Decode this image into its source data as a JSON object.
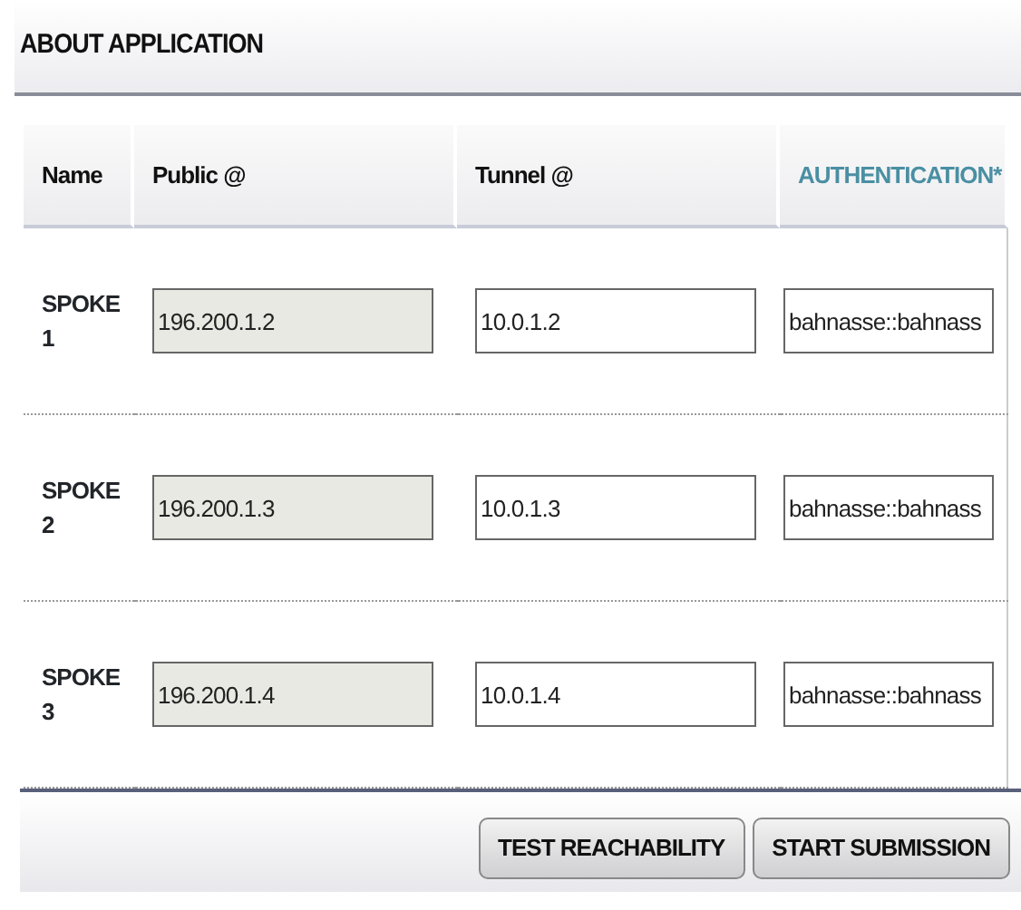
{
  "panel": {
    "title": "ABOUT APPLICATION"
  },
  "table": {
    "columns": [
      {
        "label": "Name",
        "highlighted": false
      },
      {
        "label": "Public @",
        "highlighted": false
      },
      {
        "label": "Tunnel @",
        "highlighted": false
      },
      {
        "label": "AUTHENTICATION*",
        "highlighted": true
      }
    ],
    "rows": [
      {
        "name": "SPOKE 1",
        "public": {
          "value": "196.200.1.2",
          "disabled": true
        },
        "tunnel": {
          "value": "10.0.1.2",
          "disabled": false
        },
        "authentication": {
          "value": "bahnasse::bahnass",
          "disabled": false
        }
      },
      {
        "name": "SPOKE 2",
        "public": {
          "value": "196.200.1.3",
          "disabled": true
        },
        "tunnel": {
          "value": "10.0.1.3",
          "disabled": false
        },
        "authentication": {
          "value": "bahnasse::bahnass",
          "disabled": false
        }
      },
      {
        "name": "SPOKE 3",
        "public": {
          "value": "196.200.1.4",
          "disabled": true
        },
        "tunnel": {
          "value": "10.0.1.4",
          "disabled": false
        },
        "authentication": {
          "value": "bahnasse::bahnass",
          "disabled": false
        }
      }
    ]
  },
  "buttons": [
    "TEST REACHABILITY",
    "START SUBMISSION"
  ]
}
